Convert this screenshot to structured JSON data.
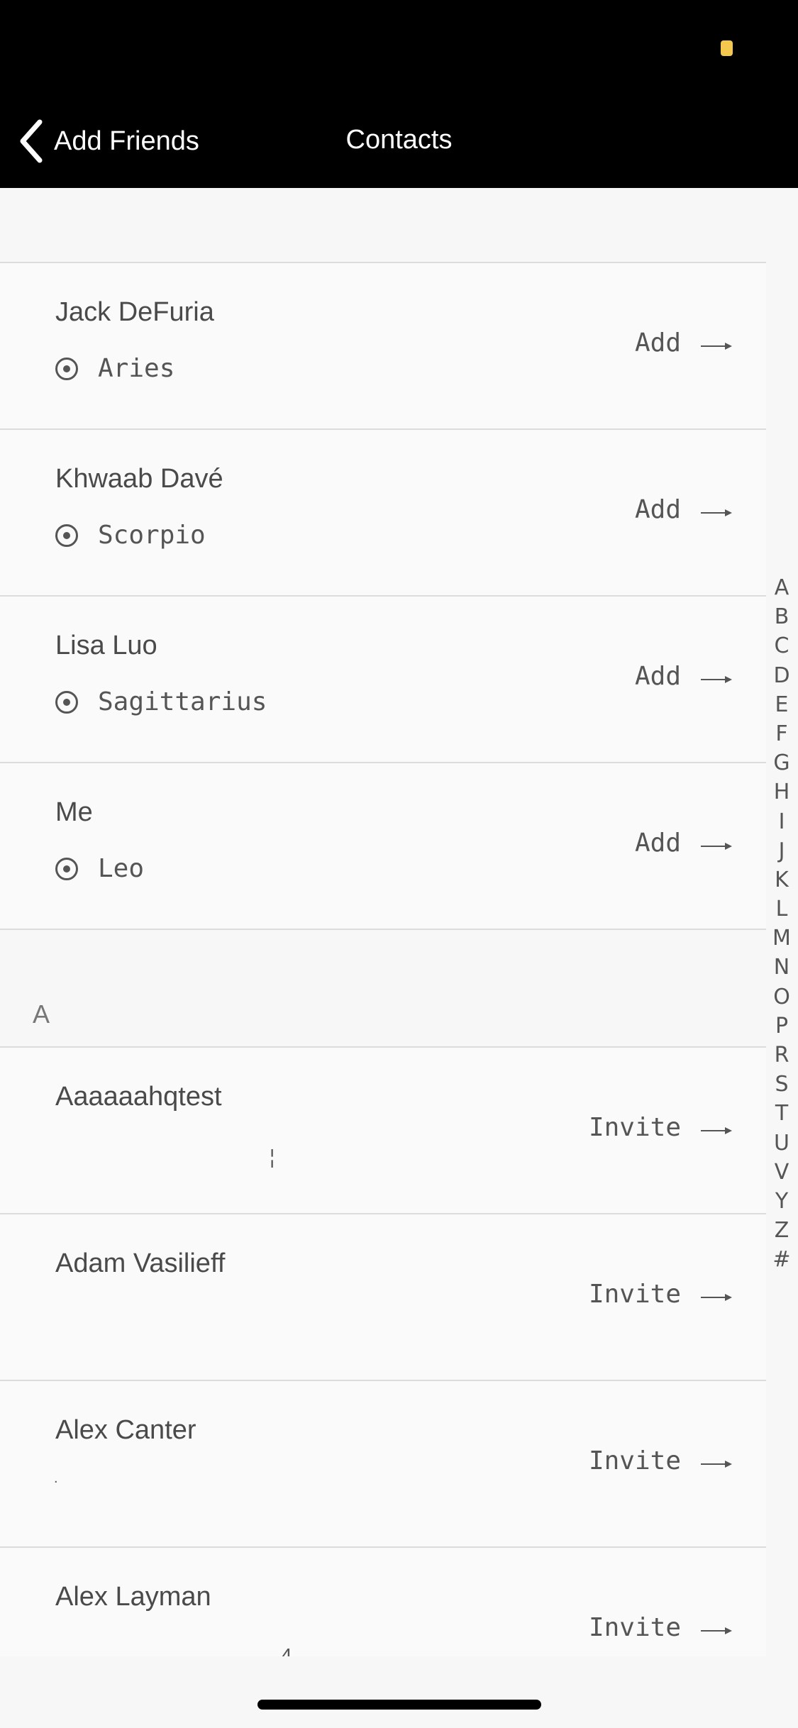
{
  "header": {
    "back_label": "Add Friends",
    "title": "Contacts",
    "status_dot_color": "#f4c84f"
  },
  "friends": [
    {
      "name": "Jack DeFuria",
      "sign": "Aries",
      "action": "Add"
    },
    {
      "name": "Khwaab Davé",
      "sign": "Scorpio",
      "action": "Add"
    },
    {
      "name": "Lisa Luo",
      "sign": "Sagittarius",
      "action": "Add"
    },
    {
      "name": "Me",
      "sign": "Leo",
      "action": "Add"
    }
  ],
  "section_a": {
    "letter": "A"
  },
  "contacts": [
    {
      "name": "Aaaaaahqtest",
      "action": "Invite",
      "faint": "¦"
    },
    {
      "name": "Adam Vasilieff",
      "action": "Invite",
      "faint": ""
    },
    {
      "name": "Alex Canter",
      "action": "Invite",
      "faint": "."
    },
    {
      "name": "Alex Layman",
      "action": "Invite",
      "faint": "4"
    }
  ],
  "index_letters": [
    "A",
    "B",
    "C",
    "D",
    "E",
    "F",
    "G",
    "H",
    "I",
    "J",
    "K",
    "L",
    "M",
    "N",
    "O",
    "P",
    "R",
    "S",
    "T",
    "U",
    "V",
    "Y",
    "Z",
    "#"
  ]
}
